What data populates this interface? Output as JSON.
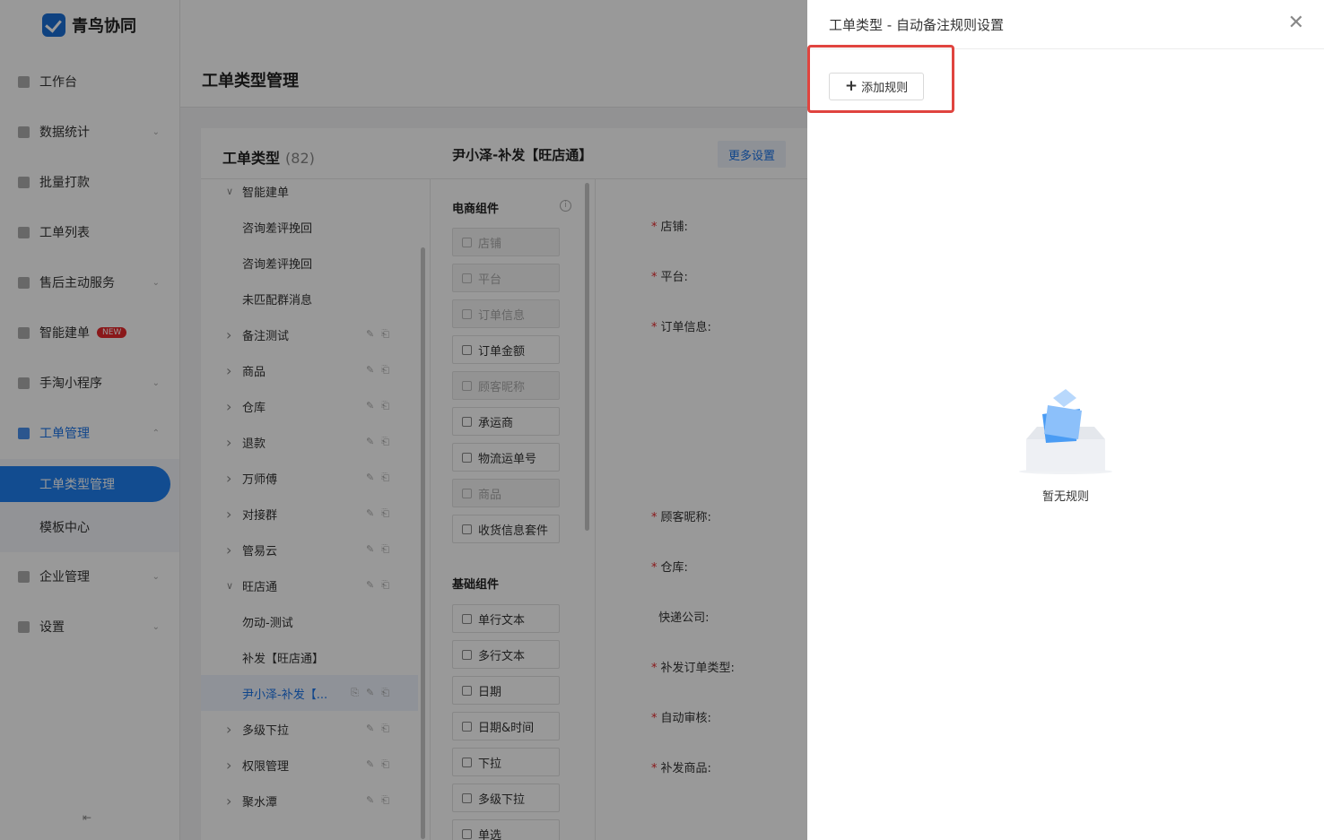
{
  "app": {
    "name": "青鸟协同"
  },
  "sidebar": {
    "items": [
      {
        "label": "工作台",
        "icon": "monitor-icon",
        "expandable": false
      },
      {
        "label": "数据统计",
        "icon": "bar-chart-icon",
        "expandable": true
      },
      {
        "label": "批量打款",
        "icon": "coin-icon",
        "expandable": false
      },
      {
        "label": "工单列表",
        "icon": "search-icon",
        "expandable": false
      },
      {
        "label": "售后主动服务",
        "icon": "chat-icon",
        "expandable": true
      },
      {
        "label": "智能建单",
        "icon": "doc-icon",
        "expandable": false,
        "badge": "NEW"
      },
      {
        "label": "手淘小程序",
        "icon": "bag-icon",
        "expandable": true
      },
      {
        "label": "工单管理",
        "icon": "edit-icon",
        "expandable": true,
        "active": true
      },
      {
        "label": "企业管理",
        "icon": "building-icon",
        "expandable": true
      },
      {
        "label": "设置",
        "icon": "gear-icon",
        "expandable": true
      }
    ],
    "sub_items": [
      "工单类型管理",
      "模板中心"
    ],
    "collapse_icon": "collapse-icon"
  },
  "page": {
    "title": "工单类型管理"
  },
  "type_list": {
    "title": "工单类型",
    "count": "(82)",
    "rows": [
      {
        "label": "智能建单",
        "arrow": "down",
        "level": 1
      },
      {
        "label": "咨询差评挽回",
        "level": 2
      },
      {
        "label": "咨询差评挽回",
        "level": 2
      },
      {
        "label": "未匹配群消息",
        "level": 2
      },
      {
        "label": "备注测试",
        "arrow": "right",
        "level": 1
      },
      {
        "label": "商品",
        "arrow": "right",
        "level": 1
      },
      {
        "label": "仓库",
        "arrow": "right",
        "level": 1
      },
      {
        "label": "退款",
        "arrow": "right",
        "level": 1
      },
      {
        "label": "万师傅",
        "arrow": "right",
        "level": 1
      },
      {
        "label": "对接群",
        "arrow": "right",
        "level": 1
      },
      {
        "label": "管易云",
        "arrow": "right",
        "level": 1
      },
      {
        "label": "旺店通",
        "arrow": "down",
        "level": 1
      },
      {
        "label": "勿动-测试",
        "level": 2
      },
      {
        "label": "补发【旺店通】",
        "level": 2
      },
      {
        "label": "尹小泽-补发【...",
        "level": 2,
        "selected": true
      },
      {
        "label": "多级下拉",
        "arrow": "right",
        "level": 1
      },
      {
        "label": "权限管理",
        "arrow": "right",
        "level": 1
      },
      {
        "label": "聚水潭",
        "arrow": "right",
        "level": 1
      }
    ]
  },
  "detail": {
    "title": "尹小泽-补发【旺店通】",
    "more_settings": "更多设置",
    "ecom_section": "电商组件",
    "ecom_components": [
      {
        "label": "店铺",
        "disabled": true
      },
      {
        "label": "平台",
        "disabled": true
      },
      {
        "label": "订单信息",
        "disabled": true
      },
      {
        "label": "订单金额",
        "disabled": false
      },
      {
        "label": "顾客昵称",
        "disabled": true
      },
      {
        "label": "承运商",
        "disabled": false
      },
      {
        "label": "物流运单号",
        "disabled": false
      },
      {
        "label": "商品",
        "disabled": true
      },
      {
        "label": "收货信息套件",
        "disabled": false
      }
    ],
    "basic_section": "基础组件",
    "basic_components": [
      "单行文本",
      "多行文本",
      "日期",
      "日期&时间",
      "下拉",
      "多级下拉",
      "单选"
    ],
    "fields": [
      {
        "label": "店铺:",
        "required": true
      },
      {
        "label": "平台:",
        "required": true
      },
      {
        "label": "订单信息:",
        "required": true
      },
      {
        "label": "顾客昵称:",
        "required": true
      },
      {
        "label": "仓库:",
        "required": true
      },
      {
        "label": "快递公司:",
        "required": false
      },
      {
        "label": "补发订单类型:",
        "required": true
      },
      {
        "label": "自动审核:",
        "required": true
      },
      {
        "label": "补发商品:",
        "required": true
      }
    ]
  },
  "drawer": {
    "title": "工单类型 - 自动备注规则设置",
    "add_rule": "添加规则",
    "empty_text": "暂无规则",
    "highlight_color": "#e0443f"
  }
}
